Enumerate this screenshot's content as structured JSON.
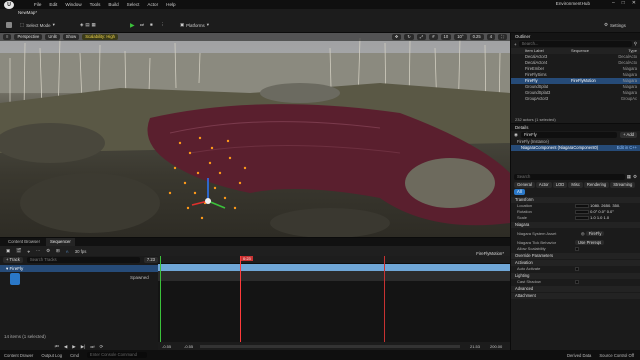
{
  "app": {
    "menu": [
      "File",
      "Edit",
      "Window",
      "Tools",
      "Build",
      "Select",
      "Actor",
      "Help"
    ],
    "project_name": "EnvironmentHub",
    "level_tab": "NewMap*"
  },
  "toolbar": {
    "select_mode": "Select Mode",
    "platforms": "Platforms",
    "settings": "Settings"
  },
  "viewport": {
    "perspective": "Perspective",
    "lit": "Unlit",
    "show": "Show",
    "scalability": "Scalability: High",
    "grid_size": "10",
    "angle": "10°",
    "scale": "0.25",
    "camera_speed": "4"
  },
  "sequencer": {
    "tabs": [
      "Content Browser",
      "Sequencer"
    ],
    "fps": "30 fps",
    "sequence_name": "FireFlyMotion*",
    "add_track": "+ Track",
    "search_placeholder": "Search Tracks",
    "track_name": "FireFly",
    "subtrack": "Spawned",
    "current_frame": "0:23",
    "frame_field": "7.23",
    "left_time": "-0.55",
    "left_time2": "-0.55",
    "right_time": "21.53",
    "right_time2": "200.00",
    "item_count": "14 items (1 selected)"
  },
  "statusbar": {
    "items": [
      "Content Drawer",
      "Output Log",
      "Cmd"
    ],
    "cmd_placeholder": "Enter Console Command",
    "right": [
      "Derived Data",
      "Source Control Off"
    ]
  },
  "outliner": {
    "title": "Outliner",
    "search_placeholder": "Search...",
    "col_label": "Item Label",
    "col_type": "Type",
    "col_seq": "Sequence",
    "rows": [
      {
        "label": "DecalActor3",
        "type": "DecalActo"
      },
      {
        "label": "DecalActor4",
        "type": "DecalActo"
      },
      {
        "label": "FireEmber",
        "type": "Niagara"
      },
      {
        "label": "FireFlySims",
        "type": "Niagara"
      },
      {
        "label": "FireFly",
        "type": "Niagara",
        "seq": "FireFlyMotion",
        "selected": true
      },
      {
        "label": "GroundSplat",
        "type": "Niagara"
      },
      {
        "label": "GroundSplat3",
        "type": "Niagara"
      },
      {
        "label": "GroupActor3",
        "type": "GroupAc"
      }
    ],
    "footer": "232 actors (1 selected)"
  },
  "details": {
    "title": "Details",
    "actor": "FireFly",
    "add_button": "+ Add",
    "instance": "FireFly (Instance)",
    "component": "NiagaraComponent (NiagaraComponent0)",
    "edit_cpp": "Edit in C++",
    "search_placeholder": "Search",
    "filter_tabs": [
      "General",
      "Actor",
      "LOD",
      "Misc",
      "Rendering",
      "Streaming",
      "All"
    ],
    "sections": {
      "transform": "Transform",
      "niagara": "Niagara",
      "override": "Override Parameters",
      "activation": "Activation",
      "lighting": "Lighting",
      "advanced": "Advanced",
      "attachment": "Attachment"
    },
    "location_label": "Location",
    "rotation_label": "Rotation",
    "scale_label": "Scale",
    "location": [
      "1080.",
      "2650.",
      "350."
    ],
    "rotation": [
      "0.0°",
      "0.0°",
      "0.0°"
    ],
    "scale": [
      "1.0",
      "1.0",
      "1.0"
    ],
    "system_asset_label": "Niagara System Asset",
    "system_asset_value": "FireFly",
    "tick_behavior_label": "Niagara Tick Behavior",
    "tick_behavior_value": "Use Prereqs",
    "allow_scalability": "Allow Scalability",
    "auto_activate": "Auto Activate",
    "cast_shadow": "Cast Shadow"
  },
  "colors": {
    "accent_blue": "#2a78c8",
    "selection": "#264b78",
    "play_green": "#3bc13b",
    "particle_orange": "#ff9a1a",
    "water_red": "#5a1f2e"
  }
}
